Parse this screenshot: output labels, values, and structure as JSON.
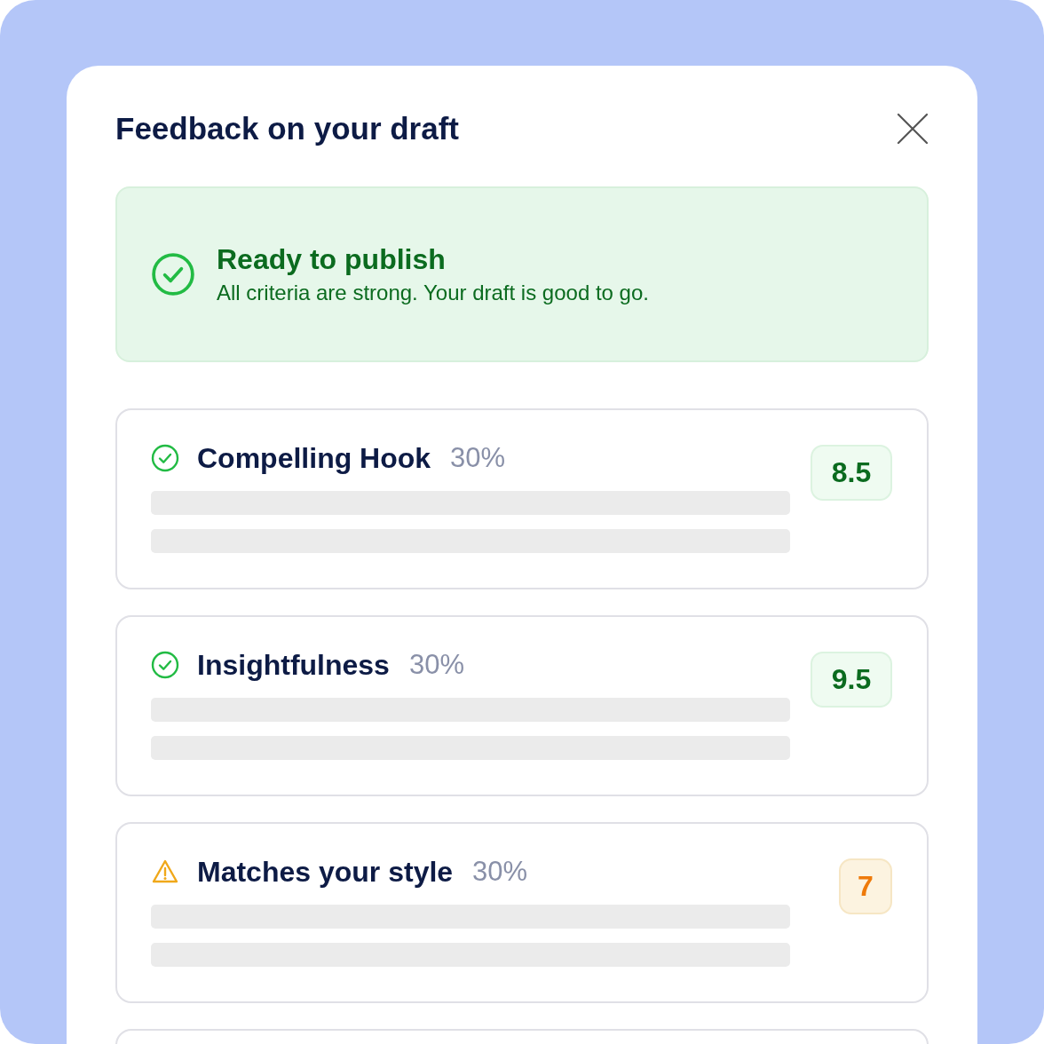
{
  "dialog": {
    "title": "Feedback on your draft"
  },
  "banner": {
    "kind": "success",
    "title": "Ready to publish",
    "message": "All criteria are strong. Your draft is good to go."
  },
  "criteria": [
    {
      "name": "Compelling Hook",
      "weight": "30%",
      "kind": "pass",
      "score": "8.5"
    },
    {
      "name": "Insightfulness",
      "weight": "30%",
      "kind": "pass",
      "score": "9.5"
    },
    {
      "name": "Matches your style",
      "weight": "30%",
      "kind": "warning",
      "score": "7"
    }
  ]
}
